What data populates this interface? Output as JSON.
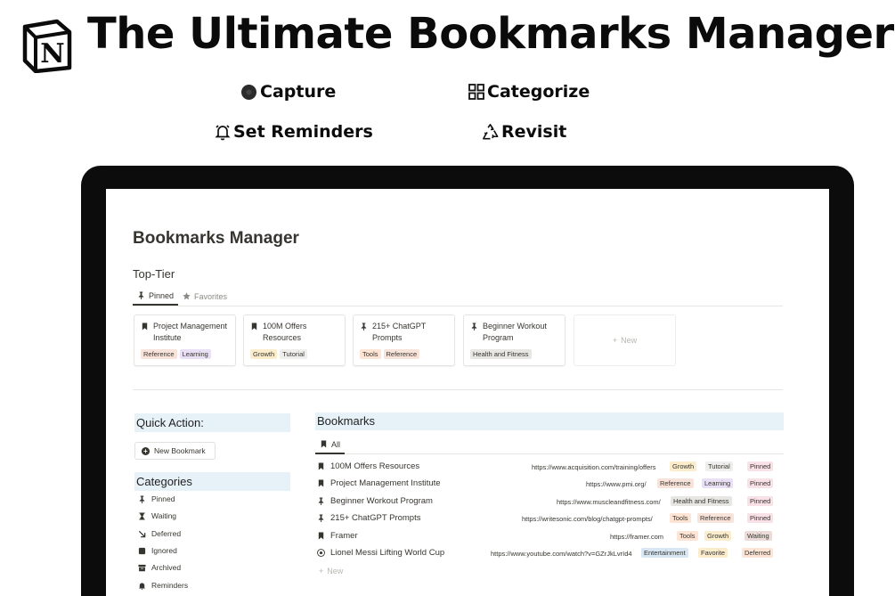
{
  "header": {
    "title": "The Ultimate Bookmarks Manager",
    "features": [
      {
        "label": "Capture",
        "icon": "record-icon"
      },
      {
        "label": "Categorize",
        "icon": "grid-icon"
      },
      {
        "label": "Set Reminders",
        "icon": "bell-icon"
      },
      {
        "label": "Revisit",
        "icon": "recycle-icon"
      }
    ]
  },
  "notion": {
    "page_title": "Bookmarks Manager",
    "top_tier": {
      "title": "Top-Tier",
      "tabs": [
        {
          "label": "Pinned",
          "icon": "pin-icon",
          "active": true
        },
        {
          "label": "Favorites",
          "icon": "star-icon",
          "active": false
        }
      ],
      "cards": [
        {
          "name": "Project Management Institute",
          "icon": "bookmark-icon",
          "tags": [
            {
              "label": "Reference",
              "color": "#f8e3da"
            },
            {
              "label": "Learning",
              "color": "#e9e0f5"
            }
          ]
        },
        {
          "name": "100M Offers Resources",
          "icon": "bookmark-icon",
          "tags": [
            {
              "label": "Growth",
              "color": "#fbeccc"
            },
            {
              "label": "Tutorial",
              "color": "#eeeeec"
            }
          ]
        },
        {
          "name": "215+ ChatGPT Prompts",
          "icon": "pin-icon",
          "tags": [
            {
              "label": "Tools",
              "color": "#fde4d5"
            },
            {
              "label": "Reference",
              "color": "#f8e3da"
            }
          ]
        },
        {
          "name": "Beginner Workout Program",
          "icon": "pin-icon",
          "tags": [
            {
              "label": "Health and Fitness",
              "color": "#e7e6e3"
            }
          ]
        }
      ],
      "new_label": "New"
    },
    "quick_action": {
      "title": "Quick Action:",
      "button_label": "New Bookmark"
    },
    "categories": {
      "title": "Categories",
      "items": [
        {
          "label": "Pinned",
          "icon": "pin-icon"
        },
        {
          "label": "Waiting",
          "icon": "hourglass-icon"
        },
        {
          "label": "Deferred",
          "icon": "arrow-down-right-icon"
        },
        {
          "label": "Ignored",
          "icon": "stop-icon"
        },
        {
          "label": "Archived",
          "icon": "archive-icon"
        },
        {
          "label": "Reminders",
          "icon": "bell-icon"
        }
      ]
    },
    "bookmarks": {
      "title": "Bookmarks",
      "tab": "All",
      "rows": [
        {
          "title": "100M Offers Resources",
          "icon": "bookmark-icon",
          "url": "https://www.acquisition.com/training/offers",
          "tags": [
            {
              "label": "Growth",
              "color": "#fbeccc"
            },
            {
              "label": "Tutorial",
              "color": "#eeeeec"
            }
          ],
          "status": {
            "label": "Pinned",
            "color": "#f9e1e8"
          }
        },
        {
          "title": "Project Management Institute",
          "icon": "bookmark-icon",
          "url": "https://www.pmi.org/",
          "tags": [
            {
              "label": "Reference",
              "color": "#f8e3da"
            },
            {
              "label": "Learning",
              "color": "#e9e0f5"
            }
          ],
          "status": {
            "label": "Pinned",
            "color": "#f9e1e8"
          }
        },
        {
          "title": "Beginner Workout Program",
          "icon": "pin-icon",
          "url": "https://www.muscleandfitness.com/",
          "tags": [
            {
              "label": "Health and Fitness",
              "color": "#e7e6e3"
            }
          ],
          "status": {
            "label": "Pinned",
            "color": "#f9e1e8"
          }
        },
        {
          "title": "215+ ChatGPT Prompts",
          "icon": "pin-icon",
          "url": "https://writesonic.com/blog/chatgpt-prompts/",
          "tags": [
            {
              "label": "Tools",
              "color": "#fde4d5"
            },
            {
              "label": "Reference",
              "color": "#f8e3da"
            }
          ],
          "status": {
            "label": "Pinned",
            "color": "#f9e1e8"
          }
        },
        {
          "title": "Framer",
          "icon": "bookmark-icon",
          "url": "https://framer.com",
          "tags": [
            {
              "label": "Tools",
              "color": "#fde4d5"
            },
            {
              "label": "Growth",
              "color": "#fbeccc"
            }
          ],
          "status": {
            "label": "Waiting",
            "color": "#ecdcd9"
          }
        },
        {
          "title": "Lionel Messi Lifting World Cup",
          "icon": "soccer-ball-icon",
          "url": "https://www.youtube.com/watch?v=GZrJkLvrId4",
          "tags": [
            {
              "label": "Entertainment",
              "color": "#d8e7f3"
            },
            {
              "label": "Favorite",
              "color": "#fbeccc"
            }
          ],
          "status": {
            "label": "Deferred",
            "color": "#fde4d5"
          }
        }
      ],
      "new_label": "New"
    }
  }
}
